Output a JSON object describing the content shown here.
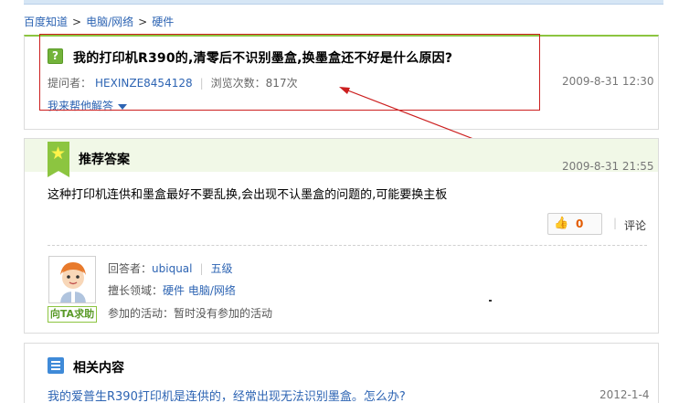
{
  "breadcrumb": {
    "items": [
      "百度知道",
      "电脑/网络",
      "硬件"
    ],
    "separator": ">"
  },
  "question": {
    "icon_label": "?",
    "title": "我的打印机R390的,清零后不识别墨盒,换墨盒还不好是什么原因?",
    "asker_label": "提问者：",
    "asker": "HEXINZE8454128",
    "views_label": "浏览次数：",
    "views": "817次",
    "date": "2009-8-31 12:30",
    "help_answer": "我来帮他解答"
  },
  "answer": {
    "heading": "推荐答案",
    "date": "2009-8-31 21:55",
    "content": "这种打印机连供和墨盒最好不要乱换,会出现不认墨盒的问题的,可能要换主板",
    "like_count": "0",
    "comment": "评论",
    "answerer_label": "回答者：",
    "answerer": "ubiqual",
    "level": "五级",
    "expertise_label": "擅长领域：",
    "expertise": "硬件 电脑/网络",
    "activity_label": "参加的活动：",
    "activity": "暂时没有参加的活动",
    "ask_help": "向TA求助"
  },
  "related": {
    "heading": "相关内容",
    "items": [
      {
        "title": "我的爱普生R390打印机是连供的，经常出现无法识别墨盒。怎么办?",
        "date": "2012-1-4"
      }
    ]
  },
  "colors": {
    "accent_green": "#8cc540",
    "link_blue": "#2d64b3",
    "annotation_red": "#cc1f1f",
    "like_orange": "#e35b00"
  }
}
